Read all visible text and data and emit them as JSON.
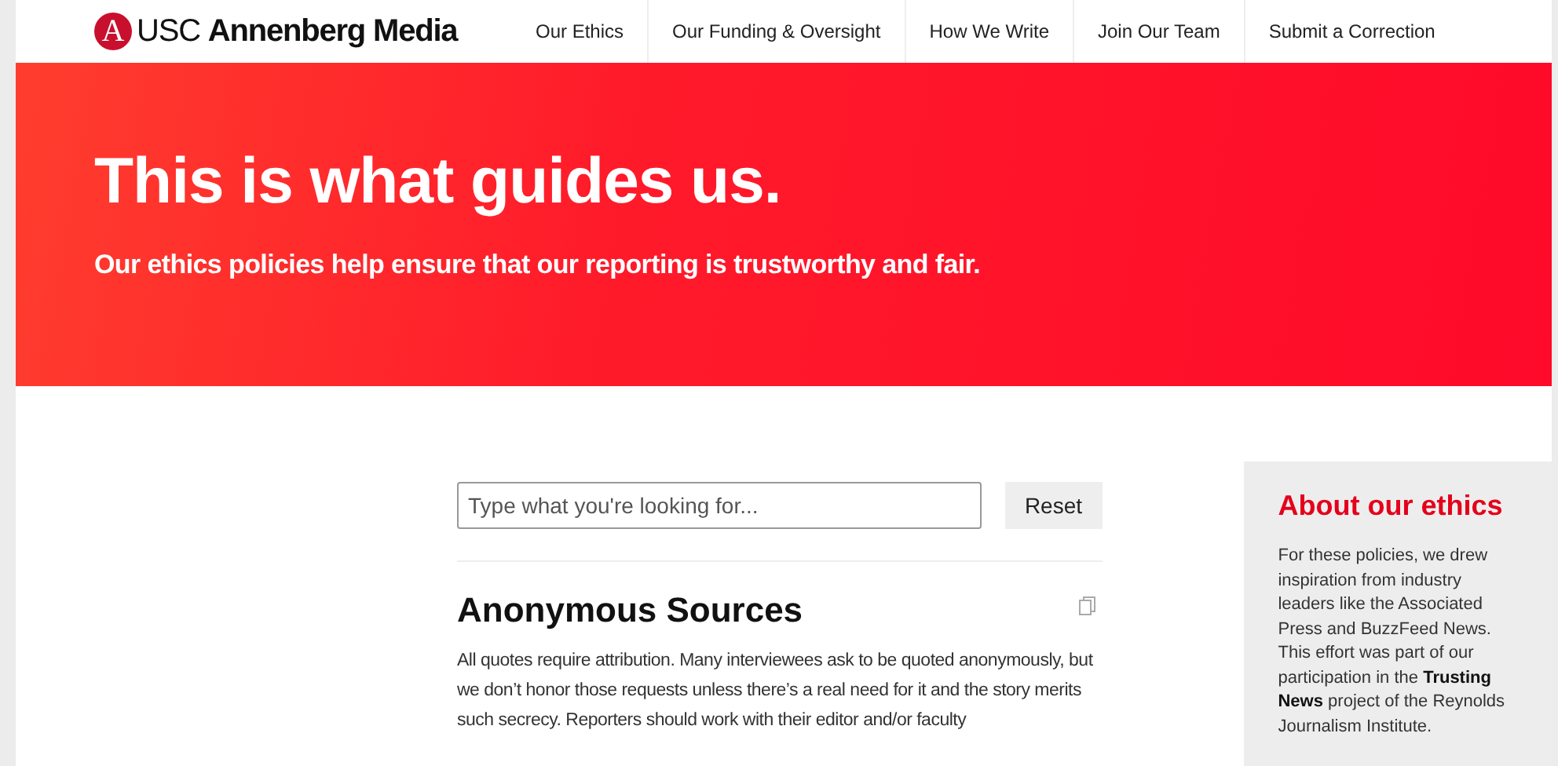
{
  "header": {
    "logo_mark": "A",
    "brand": "USC **Annenberg Media**",
    "nav": [
      {
        "label": "Our Ethics"
      },
      {
        "label": "Our Funding & Oversight"
      },
      {
        "label": "How We Write"
      },
      {
        "label": "Join Our Team"
      },
      {
        "label": "Submit a Correction"
      }
    ]
  },
  "hero": {
    "title": "This is what guides us.",
    "subtitle": "Our ethics policies help ensure that our reporting is trustworthy and fair."
  },
  "search": {
    "placeholder": "Type what you're looking for...",
    "reset": "Reset"
  },
  "section": {
    "title": "Anonymous Sources",
    "body": "All quotes require attribution. Many interviewees ask to be quoted anonymously, but we don’t honor those requests unless there’s a real need for it and the story merits such secrecy. Reporters should work with their editor and/or faculty"
  },
  "sidebar": {
    "title": "About our ethics",
    "body": "For these policies, we drew inspiration from industry leaders like the Associated Press and BuzzFeed News. This effort was part of our participation in the **Trusting News** project of the Reynolds Journalism Institute."
  }
}
